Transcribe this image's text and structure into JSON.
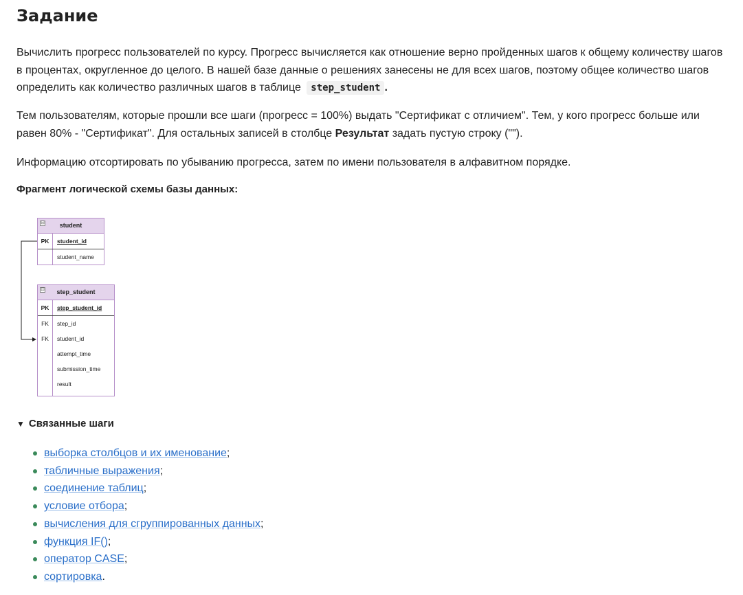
{
  "title": "Задание",
  "paragraphs": {
    "p1_text": "Вычислить прогресс пользователей по курсу. Прогресс вычисляется как отношение верно пройденных шагов к общему количеству шагов в процентах, округленное до целого. В нашей базе данные о решениях занесены не для всех шагов, поэтому общее количество шагов определить как количество различных шагов в таблице",
    "p1_code": "step_student",
    "p1_end": ".",
    "p2_text": "Тем пользователям, которые прошли все шаги (прогресс = 100%) выдать \"Сертификат с отличием\". Тем, у кого прогресс больше или равен 80% - \"Сертификат\". Для остальных записей в столбце",
    "p2_bold": "Результат",
    "p2_end": "задать пустую строку (\"\").",
    "p3_text": "Информацию отсортировать по убыванию прогресса, затем по имени пользователя в алфавитном порядке."
  },
  "schema_title": "Фрагмент логической схемы базы данных:",
  "schema": {
    "student": {
      "name": "student",
      "pk_label": "PK",
      "pk_col": "student_id",
      "cols": [
        "student_name"
      ]
    },
    "step_student": {
      "name": "step_student",
      "pk_label": "PK",
      "pk_col": "step_student_id",
      "fk_label": "FK",
      "rows": [
        {
          "key": "FK",
          "col": "step_id"
        },
        {
          "key": "FK",
          "col": "student_id"
        },
        {
          "key": "",
          "col": "attempt_time"
        },
        {
          "key": "",
          "col": "submission_time"
        },
        {
          "key": "",
          "col": "result"
        }
      ]
    },
    "collapse_symbol": "⊟"
  },
  "related": {
    "toggle_symbol": "▼",
    "title": "Связанные шаги",
    "items": [
      {
        "label": "выборка столбцов и их именование",
        "suffix": ";"
      },
      {
        "label": "табличные выражения",
        "suffix": ";"
      },
      {
        "label": "соединение таблиц",
        "suffix": ";"
      },
      {
        "label": "условие отбора",
        "suffix": ";"
      },
      {
        "label": "вычисления для сгруппированных данных",
        "suffix": ";"
      },
      {
        "label": "функция IF()",
        "suffix": ";"
      },
      {
        "label": "оператор CASE",
        "suffix": ";"
      },
      {
        "label": "сортировка",
        "suffix": "."
      }
    ]
  }
}
